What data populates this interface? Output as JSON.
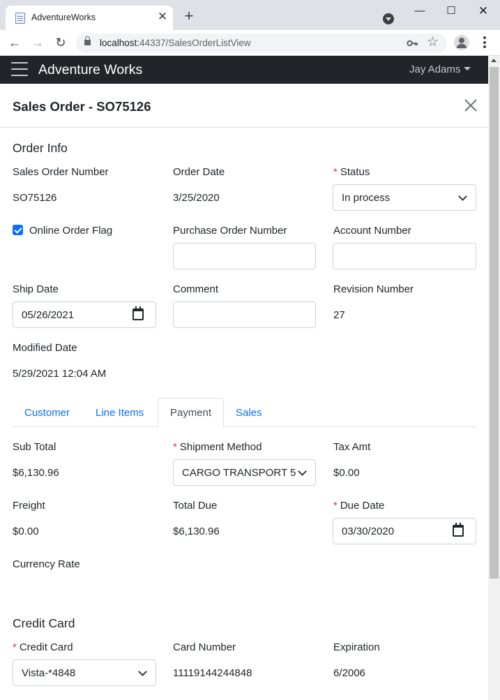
{
  "browser": {
    "tab_title": "AdventureWorks",
    "tab_close": "✕",
    "new_tab": "+",
    "url_host": "localhost:",
    "url_rest": "44337/SalesOrderListView",
    "win_minimize": "—",
    "win_maximize": "☐",
    "win_close": "✕",
    "back": "←",
    "forward": "→",
    "reload": "↻",
    "star": "☆"
  },
  "navbar": {
    "brand": "Adventure Works",
    "user": "Jay Adams"
  },
  "modal": {
    "title": "Sales Order - SO75126"
  },
  "order_info": {
    "heading": "Order Info",
    "sales_order_number_label": "Sales Order Number",
    "sales_order_number": "SO75126",
    "order_date_label": "Order Date",
    "order_date": "3/25/2020",
    "status_required": "*",
    "status_label": "Status",
    "status_value": "In process",
    "online_order_flag_label": "Online Order Flag",
    "online_order_flag_checked": true,
    "purchase_order_number_label": "Purchase Order Number",
    "purchase_order_number": "",
    "account_number_label": "Account Number",
    "account_number": "",
    "ship_date_label": "Ship Date",
    "ship_date": "05/26/2021",
    "comment_label": "Comment",
    "comment": "",
    "revision_number_label": "Revision Number",
    "revision_number": "27",
    "modified_date_label": "Modified Date",
    "modified_date": "5/29/2021 12:04 AM"
  },
  "tabs": {
    "customer": "Customer",
    "line_items": "Line Items",
    "payment": "Payment",
    "sales": "Sales",
    "active": "Payment"
  },
  "payment": {
    "sub_total_label": "Sub Total",
    "sub_total": "$6,130.96",
    "shipment_method_required": "*",
    "shipment_method_label": "Shipment Method",
    "shipment_method": "CARGO TRANSPORT 5",
    "tax_amt_label": "Tax Amt",
    "tax_amt": "$0.00",
    "freight_label": "Freight",
    "freight": "$0.00",
    "total_due_label": "Total Due",
    "total_due": "$6,130.96",
    "due_date_required": "*",
    "due_date_label": "Due Date",
    "due_date": "03/30/2020",
    "currency_rate_label": "Currency Rate",
    "currency_rate": ""
  },
  "credit_card": {
    "heading": "Credit Card",
    "credit_card_required": "*",
    "credit_card_label": "Credit Card",
    "credit_card_value": "Vista-*4848",
    "card_number_label": "Card Number",
    "card_number": "11119144244848",
    "expiration_label": "Expiration",
    "expiration": "6/2006"
  },
  "colors": {
    "navbar_bg": "#212529",
    "link": "#0d6efd",
    "required": "#dc3545",
    "checkbox": "#0d6efd"
  }
}
